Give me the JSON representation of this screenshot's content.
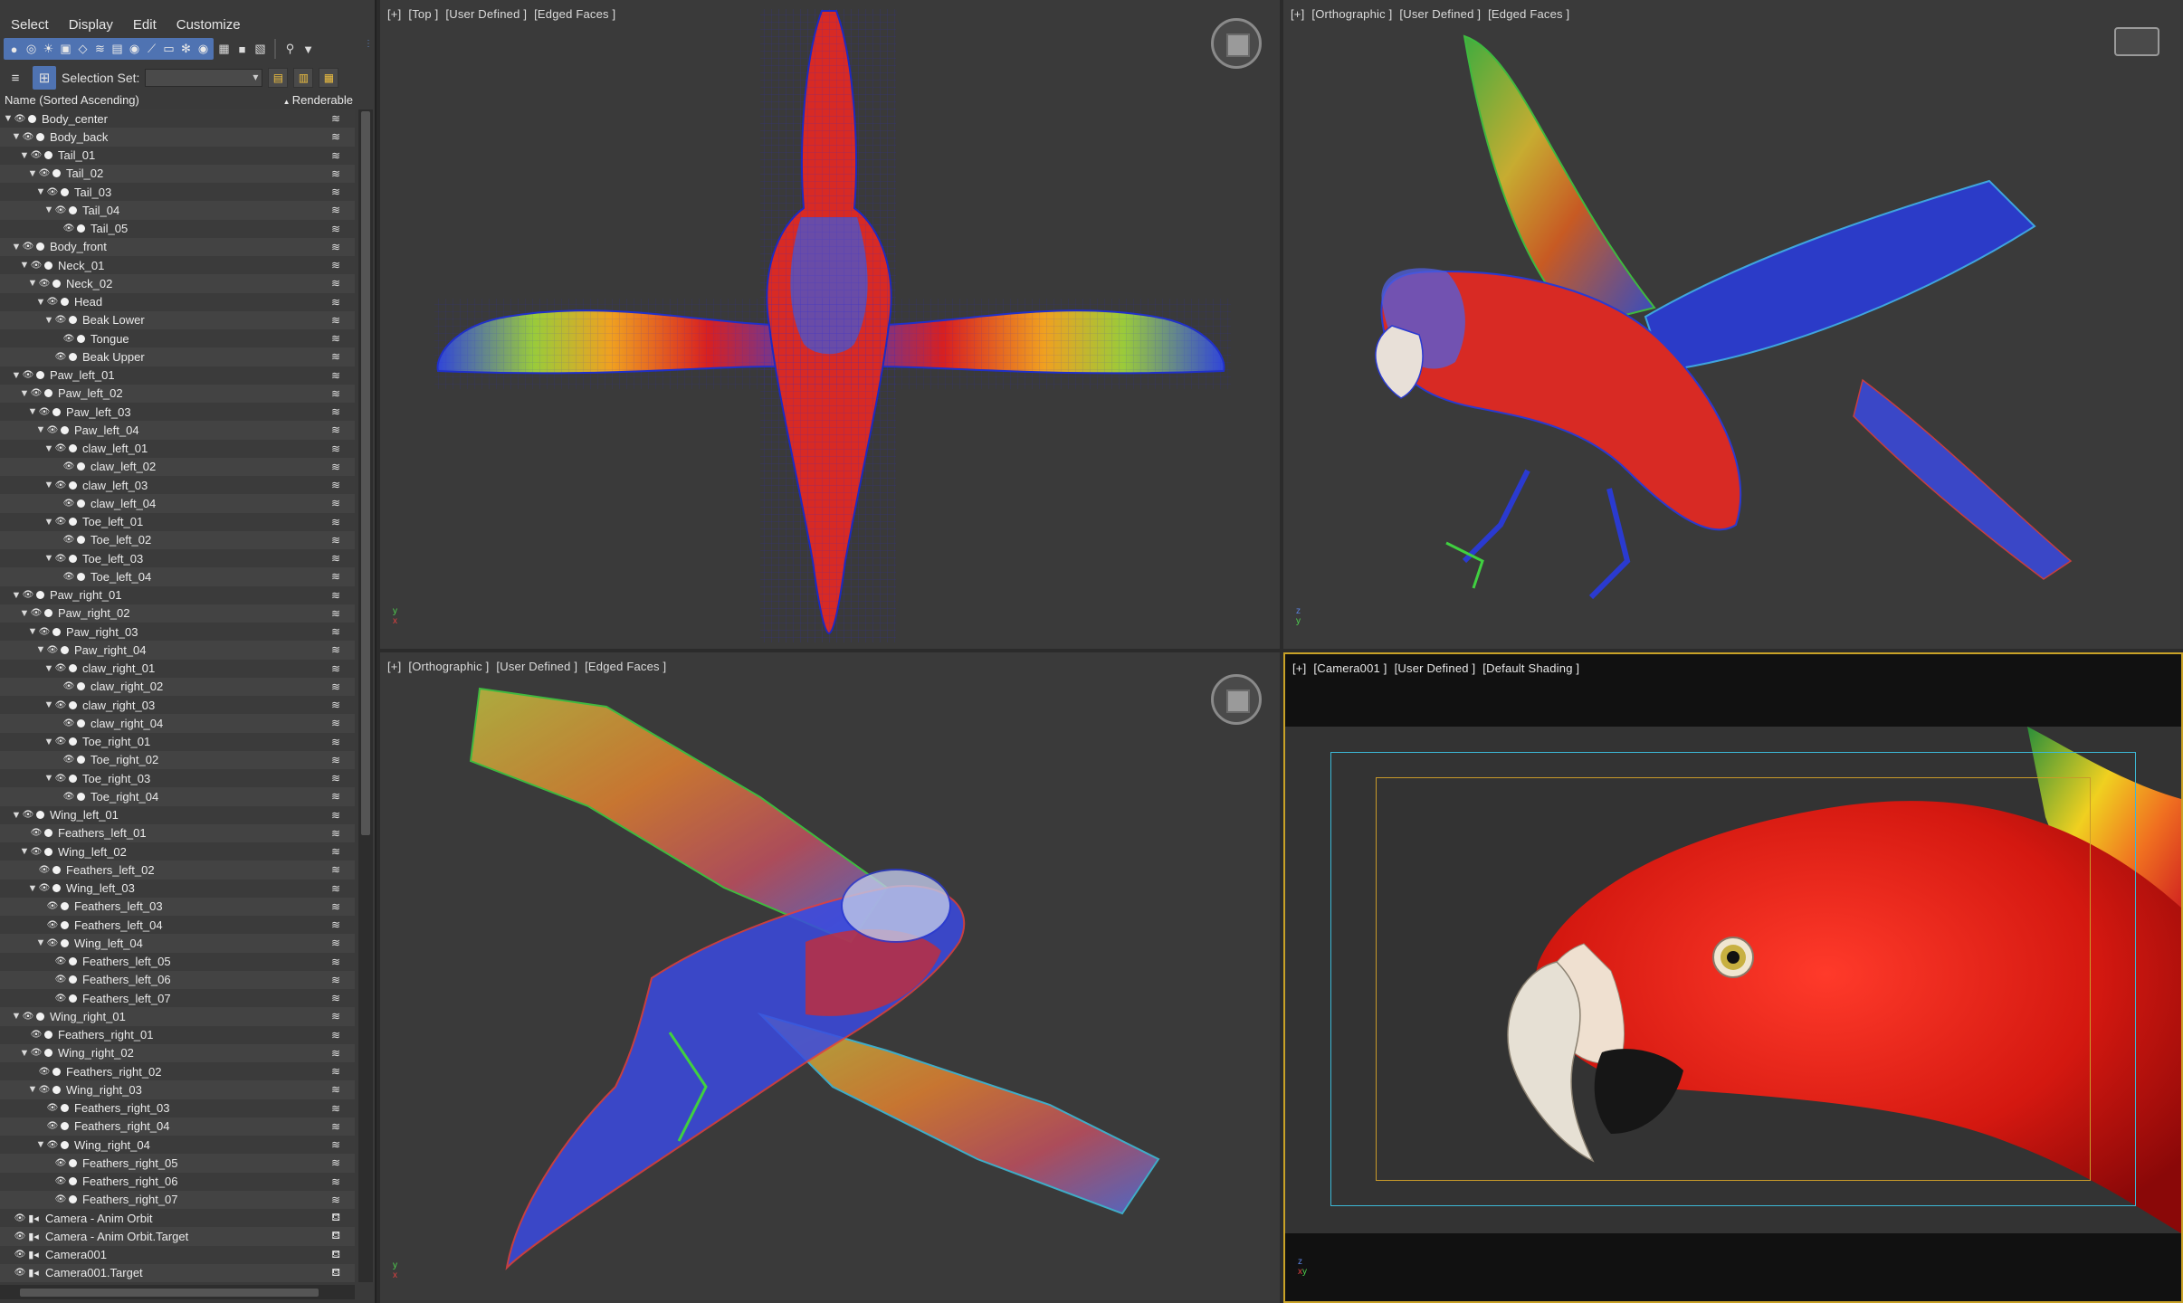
{
  "menu": [
    "Select",
    "Display",
    "Edit",
    "Customize"
  ],
  "selection_set": {
    "label": "Selection Set:",
    "value": ""
  },
  "columns": {
    "name": "Name (Sorted Ascending)",
    "renderable": "Renderable"
  },
  "tree": [
    {
      "name": "Body_center",
      "indent": 0,
      "arrow": true,
      "type": "obj"
    },
    {
      "name": "Body_back",
      "indent": 1,
      "arrow": true,
      "type": "obj"
    },
    {
      "name": "Tail_01",
      "indent": 2,
      "arrow": true,
      "type": "obj"
    },
    {
      "name": "Tail_02",
      "indent": 3,
      "arrow": true,
      "type": "obj"
    },
    {
      "name": "Tail_03",
      "indent": 4,
      "arrow": true,
      "type": "obj"
    },
    {
      "name": "Tail_04",
      "indent": 5,
      "arrow": true,
      "type": "obj"
    },
    {
      "name": "Tail_05",
      "indent": 6,
      "arrow": false,
      "type": "obj"
    },
    {
      "name": "Body_front",
      "indent": 1,
      "arrow": true,
      "type": "obj"
    },
    {
      "name": "Neck_01",
      "indent": 2,
      "arrow": true,
      "type": "obj"
    },
    {
      "name": "Neck_02",
      "indent": 3,
      "arrow": true,
      "type": "obj"
    },
    {
      "name": "Head",
      "indent": 4,
      "arrow": true,
      "type": "obj"
    },
    {
      "name": "Beak Lower",
      "indent": 5,
      "arrow": true,
      "type": "obj"
    },
    {
      "name": "Tongue",
      "indent": 6,
      "arrow": false,
      "type": "obj"
    },
    {
      "name": "Beak Upper",
      "indent": 5,
      "arrow": false,
      "type": "obj"
    },
    {
      "name": "Paw_left_01",
      "indent": 1,
      "arrow": true,
      "type": "obj"
    },
    {
      "name": "Paw_left_02",
      "indent": 2,
      "arrow": true,
      "type": "obj"
    },
    {
      "name": "Paw_left_03",
      "indent": 3,
      "arrow": true,
      "type": "obj"
    },
    {
      "name": "Paw_left_04",
      "indent": 4,
      "arrow": true,
      "type": "obj"
    },
    {
      "name": "claw_left_01",
      "indent": 5,
      "arrow": true,
      "type": "obj"
    },
    {
      "name": "claw_left_02",
      "indent": 6,
      "arrow": false,
      "type": "obj"
    },
    {
      "name": "claw_left_03",
      "indent": 5,
      "arrow": true,
      "type": "obj"
    },
    {
      "name": "claw_left_04",
      "indent": 6,
      "arrow": false,
      "type": "obj"
    },
    {
      "name": "Toe_left_01",
      "indent": 5,
      "arrow": true,
      "type": "obj"
    },
    {
      "name": "Toe_left_02",
      "indent": 6,
      "arrow": false,
      "type": "obj"
    },
    {
      "name": "Toe_left_03",
      "indent": 5,
      "arrow": true,
      "type": "obj"
    },
    {
      "name": "Toe_left_04",
      "indent": 6,
      "arrow": false,
      "type": "obj"
    },
    {
      "name": "Paw_right_01",
      "indent": 1,
      "arrow": true,
      "type": "obj"
    },
    {
      "name": "Paw_right_02",
      "indent": 2,
      "arrow": true,
      "type": "obj"
    },
    {
      "name": "Paw_right_03",
      "indent": 3,
      "arrow": true,
      "type": "obj"
    },
    {
      "name": "Paw_right_04",
      "indent": 4,
      "arrow": true,
      "type": "obj"
    },
    {
      "name": "claw_right_01",
      "indent": 5,
      "arrow": true,
      "type": "obj"
    },
    {
      "name": "claw_right_02",
      "indent": 6,
      "arrow": false,
      "type": "obj"
    },
    {
      "name": "claw_right_03",
      "indent": 5,
      "arrow": true,
      "type": "obj"
    },
    {
      "name": "claw_right_04",
      "indent": 6,
      "arrow": false,
      "type": "obj"
    },
    {
      "name": "Toe_right_01",
      "indent": 5,
      "arrow": true,
      "type": "obj"
    },
    {
      "name": "Toe_right_02",
      "indent": 6,
      "arrow": false,
      "type": "obj"
    },
    {
      "name": "Toe_right_03",
      "indent": 5,
      "arrow": true,
      "type": "obj"
    },
    {
      "name": "Toe_right_04",
      "indent": 6,
      "arrow": false,
      "type": "obj"
    },
    {
      "name": "Wing_left_01",
      "indent": 1,
      "arrow": true,
      "type": "obj"
    },
    {
      "name": "Feathers_left_01",
      "indent": 2,
      "arrow": false,
      "type": "obj"
    },
    {
      "name": "Wing_left_02",
      "indent": 2,
      "arrow": true,
      "type": "obj"
    },
    {
      "name": "Feathers_left_02",
      "indent": 3,
      "arrow": false,
      "type": "obj"
    },
    {
      "name": "Wing_left_03",
      "indent": 3,
      "arrow": true,
      "type": "obj"
    },
    {
      "name": "Feathers_left_03",
      "indent": 4,
      "arrow": false,
      "type": "obj"
    },
    {
      "name": "Feathers_left_04",
      "indent": 4,
      "arrow": false,
      "type": "obj"
    },
    {
      "name": "Wing_left_04",
      "indent": 4,
      "arrow": true,
      "type": "obj"
    },
    {
      "name": "Feathers_left_05",
      "indent": 5,
      "arrow": false,
      "type": "obj"
    },
    {
      "name": "Feathers_left_06",
      "indent": 5,
      "arrow": false,
      "type": "obj"
    },
    {
      "name": "Feathers_left_07",
      "indent": 5,
      "arrow": false,
      "type": "obj"
    },
    {
      "name": "Wing_right_01",
      "indent": 1,
      "arrow": true,
      "type": "obj"
    },
    {
      "name": "Feathers_right_01",
      "indent": 2,
      "arrow": false,
      "type": "obj"
    },
    {
      "name": "Wing_right_02",
      "indent": 2,
      "arrow": true,
      "type": "obj"
    },
    {
      "name": "Feathers_right_02",
      "indent": 3,
      "arrow": false,
      "type": "obj"
    },
    {
      "name": "Wing_right_03",
      "indent": 3,
      "arrow": true,
      "type": "obj"
    },
    {
      "name": "Feathers_right_03",
      "indent": 4,
      "arrow": false,
      "type": "obj"
    },
    {
      "name": "Feathers_right_04",
      "indent": 4,
      "arrow": false,
      "type": "obj"
    },
    {
      "name": "Wing_right_04",
      "indent": 4,
      "arrow": true,
      "type": "obj"
    },
    {
      "name": "Feathers_right_05",
      "indent": 5,
      "arrow": false,
      "type": "obj"
    },
    {
      "name": "Feathers_right_06",
      "indent": 5,
      "arrow": false,
      "type": "obj"
    },
    {
      "name": "Feathers_right_07",
      "indent": 5,
      "arrow": false,
      "type": "obj"
    },
    {
      "name": "Camera - Anim Orbit",
      "indent": 0,
      "arrow": false,
      "type": "cam"
    },
    {
      "name": "Camera - Anim Orbit.Target",
      "indent": 0,
      "arrow": false,
      "type": "cam"
    },
    {
      "name": "Camera001",
      "indent": 0,
      "arrow": false,
      "type": "cam"
    },
    {
      "name": "Camera001.Target",
      "indent": 0,
      "arrow": false,
      "type": "cam"
    }
  ],
  "viewports": {
    "top": [
      "[+]",
      "[Top ]",
      "[User Defined ]",
      "[Edged Faces ]"
    ],
    "ortho1": [
      "[+]",
      "[Orthographic ]",
      "[User Defined ]",
      "[Edged Faces ]"
    ],
    "ortho2": [
      "[+]",
      "[Orthographic ]",
      "[User Defined ]",
      "[Edged Faces ]"
    ],
    "camera": [
      "[+]",
      "[Camera001 ]",
      "[User Defined ]",
      "[Default Shading ]"
    ]
  },
  "axis": {
    "x": "x",
    "y": "y",
    "z": "z"
  },
  "colors": {
    "panel_bg": "#3a3a3a",
    "viewport_bg": "#3a3a3a",
    "accent_blue": "#4f73b2",
    "camera_border": "#c9a227",
    "safe_frame_outer": "#3cb8d6",
    "safe_frame_inner": "#c99a2a",
    "parrot_red": "#d8201a",
    "wire_blue": "#2a3cd8"
  }
}
